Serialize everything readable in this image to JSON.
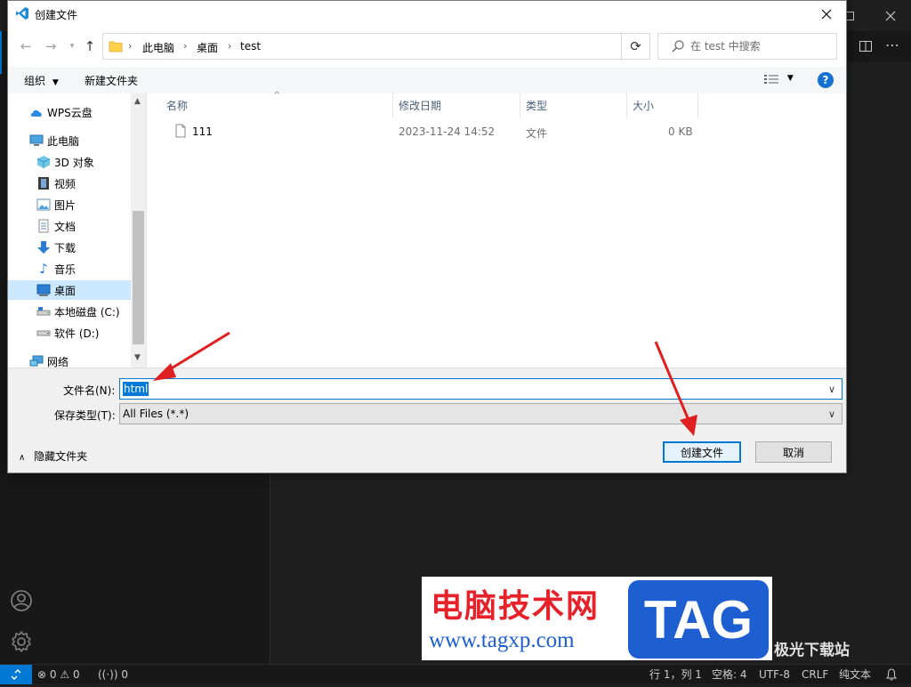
{
  "dialog": {
    "title": "创建文件",
    "close_label": "✕"
  },
  "address": {
    "crumbs": [
      "此电脑",
      "桌面",
      "test"
    ]
  },
  "search": {
    "placeholder": "在 test 中搜索"
  },
  "toolbar": {
    "organize": "组织",
    "new_folder": "新建文件夹"
  },
  "nav_pane": {
    "items": [
      {
        "label": "WPS云盘",
        "icon": "cloud-icon"
      },
      {
        "label": "此电脑",
        "icon": "computer-icon"
      },
      {
        "label": "3D 对象",
        "icon": "cube-icon"
      },
      {
        "label": "视频",
        "icon": "video-icon"
      },
      {
        "label": "图片",
        "icon": "picture-icon"
      },
      {
        "label": "文档",
        "icon": "document-icon"
      },
      {
        "label": "下载",
        "icon": "download-icon"
      },
      {
        "label": "音乐",
        "icon": "music-icon"
      },
      {
        "label": "桌面",
        "icon": "desktop-icon",
        "selected": true
      },
      {
        "label": "本地磁盘 (C:)",
        "icon": "drive-c-icon"
      },
      {
        "label": "软件 (D:)",
        "icon": "drive-d-icon"
      },
      {
        "label": "网络",
        "icon": "network-icon"
      }
    ]
  },
  "file_list": {
    "columns": [
      "名称",
      "修改日期",
      "类型",
      "大小"
    ],
    "rows": [
      {
        "name": "111",
        "modified": "2023-11-24 14:52",
        "type": "文件",
        "size": "0 KB"
      }
    ]
  },
  "form": {
    "file_name_label": "文件名(N):",
    "file_name_value": "html",
    "file_type_label": "保存类型(T):",
    "file_type_value": "All Files (*.*)",
    "hide_folders": "隐藏文件夹",
    "create_button": "创建文件",
    "cancel_button": "取消"
  },
  "status_bar": {
    "errors": "0",
    "warnings": "0",
    "ports": "0",
    "position": "行 1，列 1",
    "spaces": "空格: 4",
    "encoding": "UTF-8",
    "eol": "CRLF",
    "language": "纯文本"
  },
  "watermark": {
    "title": "电脑技术网",
    "tag": "TAG",
    "url": "www.tagxp.com",
    "site2": "极光下载站"
  },
  "colors": {
    "accent": "#0078d7",
    "selection": "#cce8ff",
    "arrow": "#e02020"
  }
}
